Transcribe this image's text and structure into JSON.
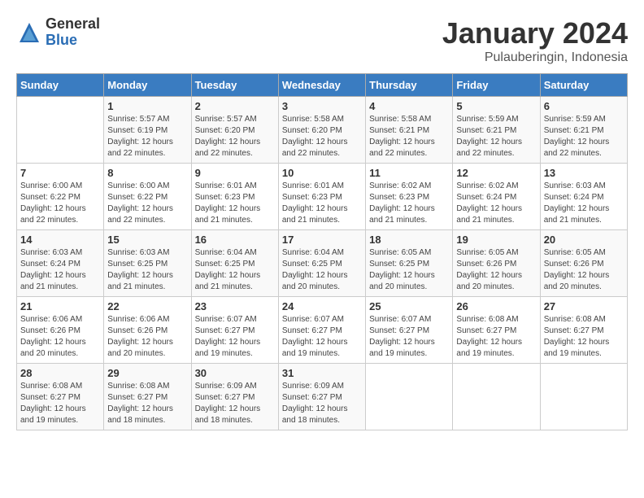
{
  "header": {
    "logo_general": "General",
    "logo_blue": "Blue",
    "month_title": "January 2024",
    "location": "Pulauberingin, Indonesia"
  },
  "days_of_week": [
    "Sunday",
    "Monday",
    "Tuesday",
    "Wednesday",
    "Thursday",
    "Friday",
    "Saturday"
  ],
  "weeks": [
    [
      {
        "day": "",
        "sunrise": "",
        "sunset": "",
        "daylight": ""
      },
      {
        "day": "1",
        "sunrise": "Sunrise: 5:57 AM",
        "sunset": "Sunset: 6:19 PM",
        "daylight": "Daylight: 12 hours and 22 minutes."
      },
      {
        "day": "2",
        "sunrise": "Sunrise: 5:57 AM",
        "sunset": "Sunset: 6:20 PM",
        "daylight": "Daylight: 12 hours and 22 minutes."
      },
      {
        "day": "3",
        "sunrise": "Sunrise: 5:58 AM",
        "sunset": "Sunset: 6:20 PM",
        "daylight": "Daylight: 12 hours and 22 minutes."
      },
      {
        "day": "4",
        "sunrise": "Sunrise: 5:58 AM",
        "sunset": "Sunset: 6:21 PM",
        "daylight": "Daylight: 12 hours and 22 minutes."
      },
      {
        "day": "5",
        "sunrise": "Sunrise: 5:59 AM",
        "sunset": "Sunset: 6:21 PM",
        "daylight": "Daylight: 12 hours and 22 minutes."
      },
      {
        "day": "6",
        "sunrise": "Sunrise: 5:59 AM",
        "sunset": "Sunset: 6:21 PM",
        "daylight": "Daylight: 12 hours and 22 minutes."
      }
    ],
    [
      {
        "day": "7",
        "sunrise": "Sunrise: 6:00 AM",
        "sunset": "Sunset: 6:22 PM",
        "daylight": "Daylight: 12 hours and 22 minutes."
      },
      {
        "day": "8",
        "sunrise": "Sunrise: 6:00 AM",
        "sunset": "Sunset: 6:22 PM",
        "daylight": "Daylight: 12 hours and 22 minutes."
      },
      {
        "day": "9",
        "sunrise": "Sunrise: 6:01 AM",
        "sunset": "Sunset: 6:23 PM",
        "daylight": "Daylight: 12 hours and 21 minutes."
      },
      {
        "day": "10",
        "sunrise": "Sunrise: 6:01 AM",
        "sunset": "Sunset: 6:23 PM",
        "daylight": "Daylight: 12 hours and 21 minutes."
      },
      {
        "day": "11",
        "sunrise": "Sunrise: 6:02 AM",
        "sunset": "Sunset: 6:23 PM",
        "daylight": "Daylight: 12 hours and 21 minutes."
      },
      {
        "day": "12",
        "sunrise": "Sunrise: 6:02 AM",
        "sunset": "Sunset: 6:24 PM",
        "daylight": "Daylight: 12 hours and 21 minutes."
      },
      {
        "day": "13",
        "sunrise": "Sunrise: 6:03 AM",
        "sunset": "Sunset: 6:24 PM",
        "daylight": "Daylight: 12 hours and 21 minutes."
      }
    ],
    [
      {
        "day": "14",
        "sunrise": "Sunrise: 6:03 AM",
        "sunset": "Sunset: 6:24 PM",
        "daylight": "Daylight: 12 hours and 21 minutes."
      },
      {
        "day": "15",
        "sunrise": "Sunrise: 6:03 AM",
        "sunset": "Sunset: 6:25 PM",
        "daylight": "Daylight: 12 hours and 21 minutes."
      },
      {
        "day": "16",
        "sunrise": "Sunrise: 6:04 AM",
        "sunset": "Sunset: 6:25 PM",
        "daylight": "Daylight: 12 hours and 21 minutes."
      },
      {
        "day": "17",
        "sunrise": "Sunrise: 6:04 AM",
        "sunset": "Sunset: 6:25 PM",
        "daylight": "Daylight: 12 hours and 20 minutes."
      },
      {
        "day": "18",
        "sunrise": "Sunrise: 6:05 AM",
        "sunset": "Sunset: 6:25 PM",
        "daylight": "Daylight: 12 hours and 20 minutes."
      },
      {
        "day": "19",
        "sunrise": "Sunrise: 6:05 AM",
        "sunset": "Sunset: 6:26 PM",
        "daylight": "Daylight: 12 hours and 20 minutes."
      },
      {
        "day": "20",
        "sunrise": "Sunrise: 6:05 AM",
        "sunset": "Sunset: 6:26 PM",
        "daylight": "Daylight: 12 hours and 20 minutes."
      }
    ],
    [
      {
        "day": "21",
        "sunrise": "Sunrise: 6:06 AM",
        "sunset": "Sunset: 6:26 PM",
        "daylight": "Daylight: 12 hours and 20 minutes."
      },
      {
        "day": "22",
        "sunrise": "Sunrise: 6:06 AM",
        "sunset": "Sunset: 6:26 PM",
        "daylight": "Daylight: 12 hours and 20 minutes."
      },
      {
        "day": "23",
        "sunrise": "Sunrise: 6:07 AM",
        "sunset": "Sunset: 6:27 PM",
        "daylight": "Daylight: 12 hours and 19 minutes."
      },
      {
        "day": "24",
        "sunrise": "Sunrise: 6:07 AM",
        "sunset": "Sunset: 6:27 PM",
        "daylight": "Daylight: 12 hours and 19 minutes."
      },
      {
        "day": "25",
        "sunrise": "Sunrise: 6:07 AM",
        "sunset": "Sunset: 6:27 PM",
        "daylight": "Daylight: 12 hours and 19 minutes."
      },
      {
        "day": "26",
        "sunrise": "Sunrise: 6:08 AM",
        "sunset": "Sunset: 6:27 PM",
        "daylight": "Daylight: 12 hours and 19 minutes."
      },
      {
        "day": "27",
        "sunrise": "Sunrise: 6:08 AM",
        "sunset": "Sunset: 6:27 PM",
        "daylight": "Daylight: 12 hours and 19 minutes."
      }
    ],
    [
      {
        "day": "28",
        "sunrise": "Sunrise: 6:08 AM",
        "sunset": "Sunset: 6:27 PM",
        "daylight": "Daylight: 12 hours and 19 minutes."
      },
      {
        "day": "29",
        "sunrise": "Sunrise: 6:08 AM",
        "sunset": "Sunset: 6:27 PM",
        "daylight": "Daylight: 12 hours and 18 minutes."
      },
      {
        "day": "30",
        "sunrise": "Sunrise: 6:09 AM",
        "sunset": "Sunset: 6:27 PM",
        "daylight": "Daylight: 12 hours and 18 minutes."
      },
      {
        "day": "31",
        "sunrise": "Sunrise: 6:09 AM",
        "sunset": "Sunset: 6:27 PM",
        "daylight": "Daylight: 12 hours and 18 minutes."
      },
      {
        "day": "",
        "sunrise": "",
        "sunset": "",
        "daylight": ""
      },
      {
        "day": "",
        "sunrise": "",
        "sunset": "",
        "daylight": ""
      },
      {
        "day": "",
        "sunrise": "",
        "sunset": "",
        "daylight": ""
      }
    ]
  ]
}
